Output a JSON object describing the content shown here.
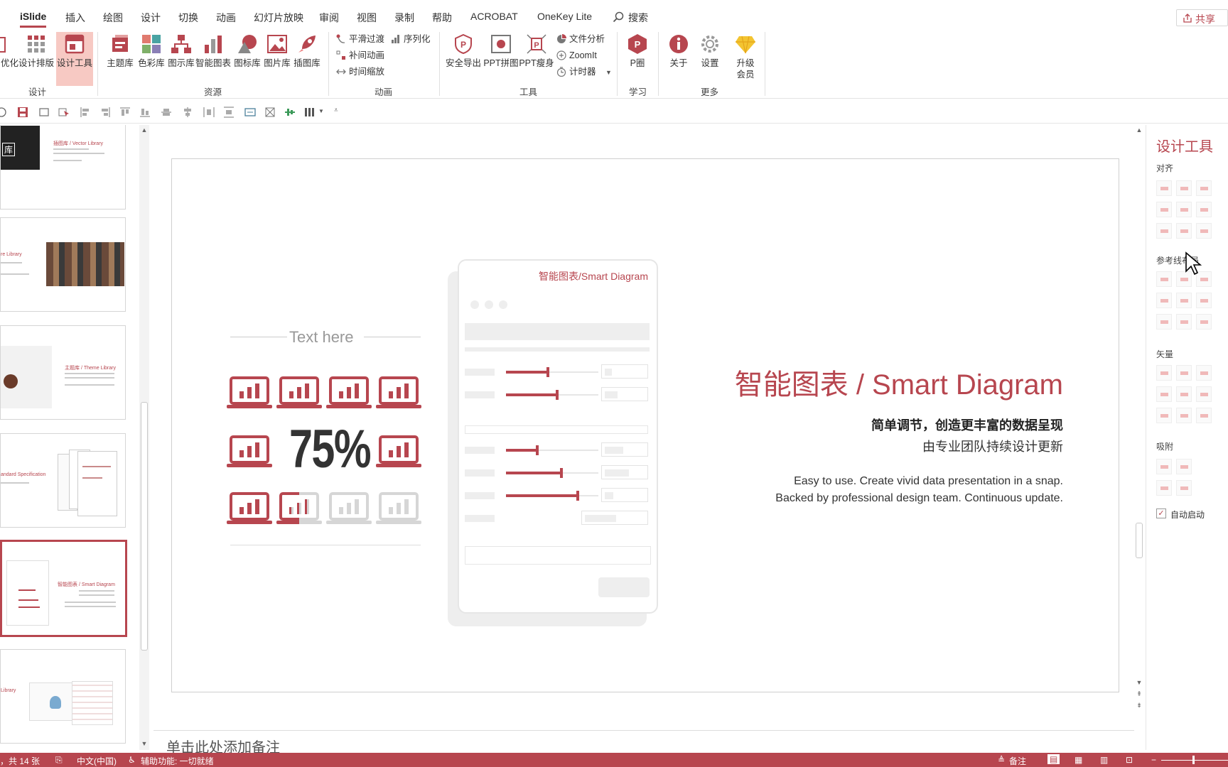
{
  "menu": {
    "tabs": [
      "iSlide",
      "插入",
      "绘图",
      "设计",
      "切换",
      "动画",
      "幻灯片放映",
      "审阅",
      "视图",
      "录制",
      "帮助",
      "ACROBAT",
      "OneKey Lite"
    ],
    "search_label": "搜索",
    "share_label": "共享"
  },
  "ribbon": {
    "design_group": {
      "label": "设计",
      "optimize": "优化",
      "layout": "设计排版",
      "tools": "设计工具"
    },
    "resource_group": {
      "label": "资源",
      "items": [
        "主题库",
        "色彩库",
        "图示库",
        "智能图表",
        "图标库",
        "图片库",
        "插图库"
      ]
    },
    "animation_group": {
      "label": "动画",
      "smooth": "平滑过渡",
      "sequence": "序列化",
      "tween": "补间动画",
      "timezoom": "时间缩放"
    },
    "tool_group": {
      "label": "工具",
      "export": "安全导出",
      "collage": "PPT拼图",
      "slim": "PPT瘦身",
      "analyze": "文件分析",
      "zoomit": "ZoomIt",
      "timer": "计时器"
    },
    "learn_group": {
      "label": "学习",
      "pcircle": "P圈"
    },
    "more_group": {
      "label": "更多",
      "about": "关于",
      "settings": "设置",
      "upgrade_line1": "升级",
      "upgrade_line2": "会员"
    }
  },
  "thumbnails": [
    {
      "title": "插图库 / Vector Library",
      "badge": "库"
    },
    {
      "title": "re Library"
    },
    {
      "title": "主题库 / Theme Library"
    },
    {
      "title": "andard Specification"
    },
    {
      "title": "智能图表 / Smart Diagram"
    },
    {
      "title": "Library"
    }
  ],
  "slide": {
    "text_here": "Text here",
    "percent": "75%",
    "card_title": "智能图表/Smart Diagram",
    "heading": "智能图表 / Smart Diagram",
    "subtitle_bold": "简单调节，创造更丰富的数据呈现",
    "subtitle": "由专业团队持续设计更新",
    "desc_line1": "Easy to use. Create vivid data presentation in a snap.",
    "desc_line2": "Backed by professional design team. Continuous update.",
    "sliders": [
      0.45,
      0.55,
      0.34,
      0.6,
      0.78
    ]
  },
  "notes_placeholder": "单击此处添加备注",
  "pane": {
    "title": "设计工具",
    "sections": {
      "align": "对齐",
      "guides": "参考线布局",
      "vector": "矢量",
      "snap": "吸附"
    },
    "autostart_label": "自动启动",
    "autostart_checked": true
  },
  "statusbar": {
    "slide_info": "，共 14 张",
    "language": "中文(中国)",
    "accessibility": "辅助功能: 一切就绪",
    "notes": "备注"
  },
  "colors": {
    "accent": "#b7464f",
    "accent_light": "#f7c9c3"
  }
}
